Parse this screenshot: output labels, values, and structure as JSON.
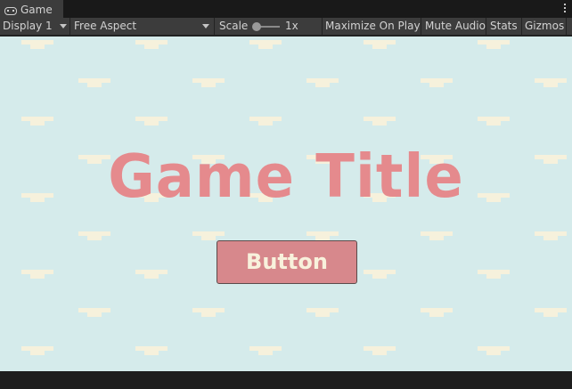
{
  "tab": {
    "label": "Game",
    "icon": "gamepad-icon"
  },
  "toolbar": {
    "display": "Display 1",
    "aspect": "Free Aspect",
    "scale_label": "Scale",
    "scale_value": "1x",
    "maximize": "Maximize On Play",
    "mute": "Mute Audio",
    "stats": "Stats",
    "gizmos": "Gizmos"
  },
  "game": {
    "title": "Game Title",
    "button": "Button",
    "colors": {
      "background": "#d5ebeb",
      "title": "#e58a8d",
      "button": "#d7888c",
      "button_text": "#f8f1dc",
      "pattern": "#f6f1dc"
    }
  }
}
